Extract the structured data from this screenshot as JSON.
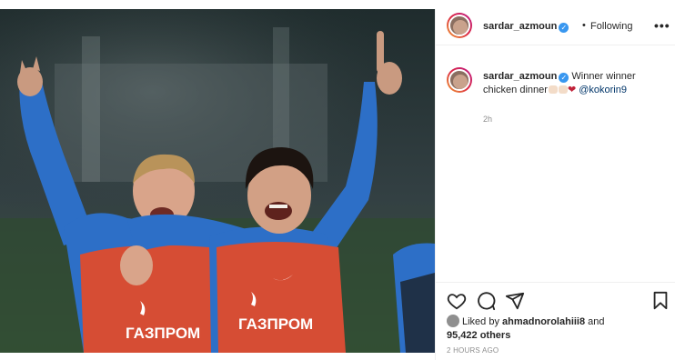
{
  "header": {
    "username": "sardar_azmoun",
    "verified_icon": "verified-badge-icon",
    "separator": "•",
    "following_label": "Following",
    "more_icon": "more-options-icon",
    "more_glyph": "•••"
  },
  "caption": {
    "username": "sardar_azmoun",
    "text": "Winner winner chicken dinner",
    "emoji": "❤",
    "mention": "@kokorin9",
    "time": "2h"
  },
  "photo": {
    "bib_text_left": "ГАЗПРОМ",
    "bib_text_right": "ГАЗПРОМ"
  },
  "actions": {
    "like_icon": "heart-outline-icon",
    "comment_icon": "comment-bubble-icon",
    "share_icon": "paper-plane-icon",
    "save_icon": "bookmark-icon"
  },
  "likes": {
    "prefix": "Liked by ",
    "user": "ahmadnorolahiii8",
    "middle": " and",
    "count": "95,422 others"
  },
  "timestamp": "2 HOURS AGO",
  "colors": {
    "accent": "#3897f0",
    "mention": "#003569",
    "heart": "#c0233a",
    "muted": "#8e8e8e"
  }
}
